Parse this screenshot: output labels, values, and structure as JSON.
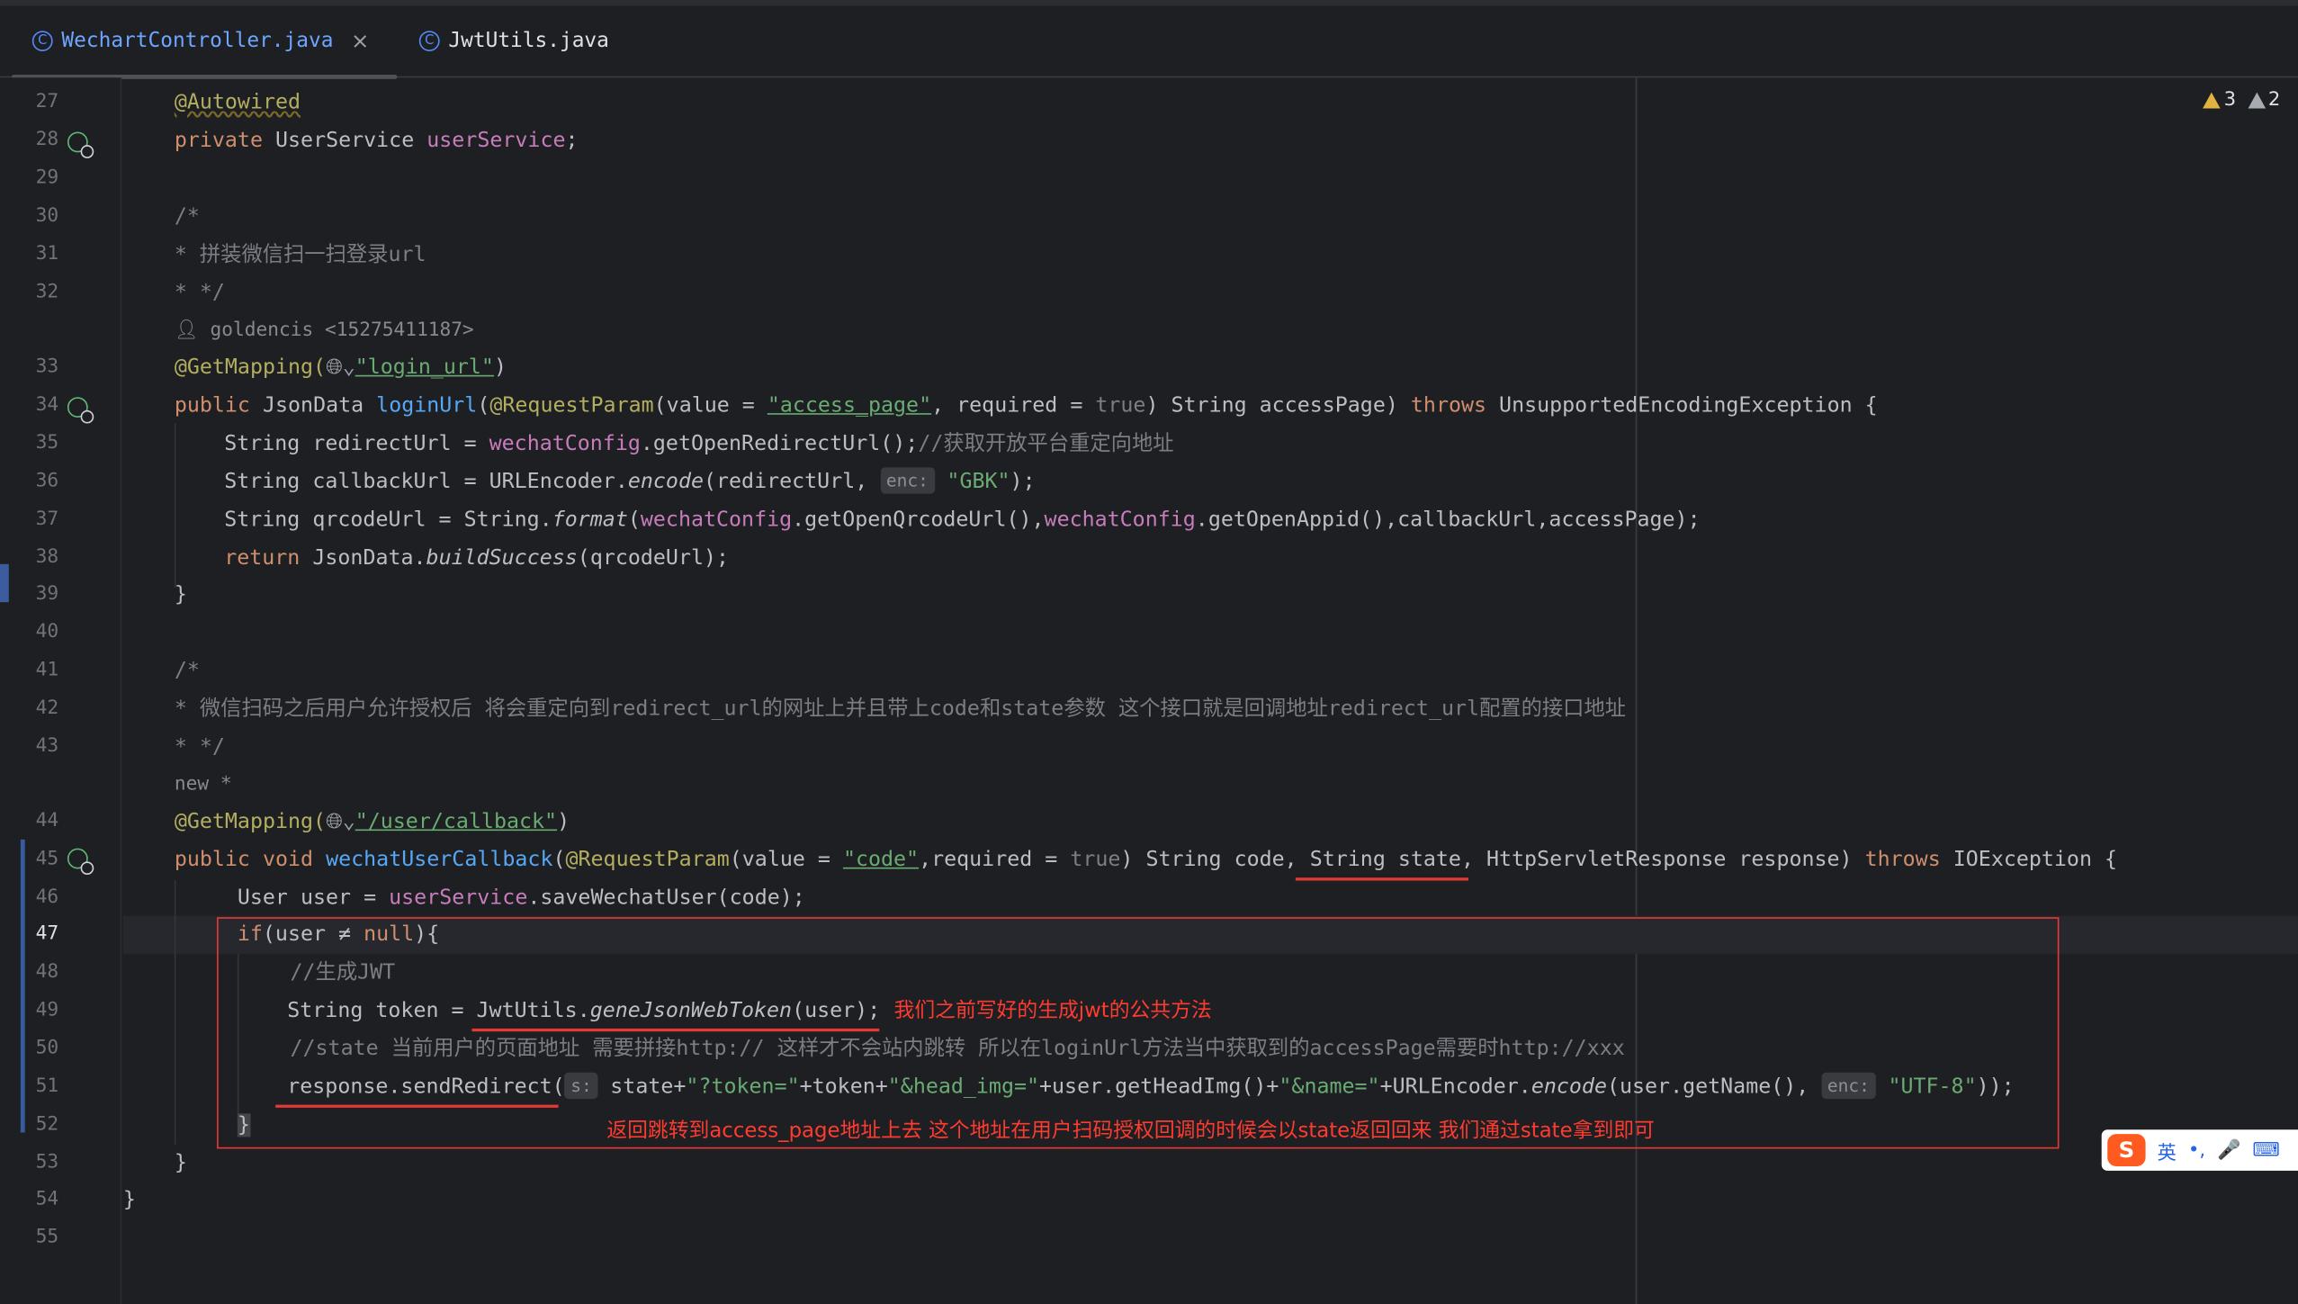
{
  "tabs": [
    {
      "label": "WechartController.java",
      "icon": "class-icon",
      "active": true,
      "closable": true
    },
    {
      "label": "JwtUtils.java",
      "icon": "class-icon",
      "active": false,
      "closable": false
    }
  ],
  "inspections": {
    "warnings": "3",
    "weak_warnings": "2"
  },
  "line_numbers": [
    "27",
    "28",
    "29",
    "30",
    "31",
    "32",
    "33",
    "34",
    "35",
    "36",
    "37",
    "38",
    "39",
    "40",
    "41",
    "42",
    "43",
    "44",
    "45",
    "46",
    "47",
    "48",
    "49",
    "50",
    "51",
    "52",
    "53",
    "54",
    "55"
  ],
  "code": {
    "l27": "@Autowired",
    "l28_kw": "private",
    "l28_type": " UserService ",
    "l28_field": "userService",
    "l28_end": ";",
    "l30": "/*",
    "l31": "* 拼装微信扫一扫登录url",
    "l32": "* */",
    "author": "goldencis <15275411187>",
    "l33_ann": "@GetMapping(",
    "l33_str": "\"login_url\"",
    "l33_end": ")",
    "l34": {
      "p1": "public",
      "p2": " JsonData ",
      "p3": "loginUrl",
      "p4": "(",
      "p5": "@RequestParam",
      "p6": "(value = ",
      "p7": "\"access_page\"",
      "p8": ", required = ",
      "p9": "true",
      "p10": ") String accessPage) ",
      "p11": "throws",
      "p12": " UnsupportedEncodingException {"
    },
    "l35": {
      "p1": "String redirectUrl = ",
      "p2": "wechatConfig",
      "p3": ".getOpenRedirectUrl();",
      "p4": "//获取开放平台重定向地址"
    },
    "l36": {
      "p1": "String callbackUrl = URLEncoder.",
      "p2": "encode",
      "p3": "(redirectUrl, ",
      "hint": "enc:",
      "p4": "\"GBK\"",
      "p5": ");"
    },
    "l37": {
      "p1": "String qrcodeUrl = String.",
      "p2": "format",
      "p3": "(",
      "p4": "wechatConfig",
      "p5": ".getOpenQrcodeUrl(),",
      "p6": "wechatConfig",
      "p7": ".getOpenAppid(),callbackUrl,accessPage);"
    },
    "l38": {
      "p1": "return",
      "p2": " JsonData.",
      "p3": "buildSuccess",
      "p4": "(qrcodeUrl);"
    },
    "l39": "}",
    "l41": "/*",
    "l42": "* 微信扫码之后用户允许授权后 将会重定向到redirect_url的网址上并且带上code和state参数 这个接口就是回调地址redirect_url配置的接口地址",
    "l43": "* */",
    "new_hint": "new *",
    "l44_ann": "@GetMapping(",
    "l44_str": "\"/user/callback\"",
    "l44_end": ")",
    "l45": {
      "p1": "public",
      "p2": " ",
      "p3": "void",
      "p4": " ",
      "p5": "wechatUserCallback",
      "p6": "(",
      "p7": "@RequestParam",
      "p8": "(value = ",
      "p9": "\"code\"",
      "p10": ",required = ",
      "p11": "true",
      "p12": ") String code, String state, HttpServletResponse response) ",
      "p13": "throws",
      "p14": " IOException {"
    },
    "l46": {
      "p1": "User user = ",
      "p2": "userService",
      "p3": ".saveWechatUser(code);"
    },
    "l47": {
      "p1": "if",
      "p2": "(user ≠ ",
      "p3": "null",
      "p4": "){"
    },
    "l48": "//生成JWT",
    "l49": {
      "p1": "String token = JwtUtils.",
      "p2": "geneJsonWebToken",
      "p3": "(user);"
    },
    "l50": "//state 当前用户的页面地址 需要拼接http:// 这样才不会站内跳转 所以在loginUrl方法当中获取到的accessPage需要时http://xxx",
    "l51": {
      "p1": "response.sendRedirect(",
      "hint1": "s:",
      "p2": " state+",
      "p3": "\"?token=\"",
      "p4": "+token+",
      "p5": "\"&head_img=\"",
      "p6": "+user.getHeadImg()+",
      "p7": "\"&name=\"",
      "p8": "+URLEncoder.",
      "p9": "encode",
      "p10": "(user.getName(), ",
      "hint2": "enc:",
      "p11": "\"UTF-8\"",
      "p12": "));"
    },
    "l52": "}",
    "l53": "}",
    "l54": "}"
  },
  "annotations_text": {
    "note1": "我们之前写好的生成jwt的公共方法",
    "note2": "返回跳转到access_page地址上去 这个地址在用户扫码授权回调的时候会以state返回回来 我们通过state拿到即可"
  },
  "ime": {
    "lang": "英",
    "punct": "•,",
    "mic": "🎤",
    "keyboard": "⌨"
  }
}
